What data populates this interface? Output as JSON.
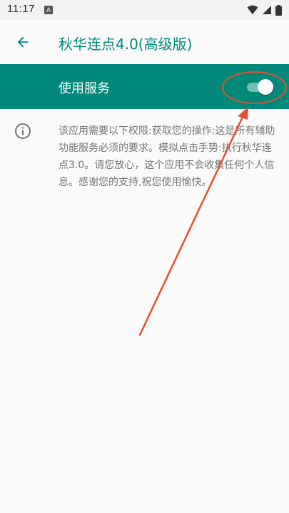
{
  "status_bar": {
    "time": "11:17",
    "notification_icon": "A",
    "icons": [
      "wifi-icon",
      "signal-icon",
      "battery-icon"
    ]
  },
  "app_bar": {
    "back_icon": "arrow-left-icon",
    "title": "秋华连点4.0(高级版)"
  },
  "service": {
    "label": "使用服务",
    "toggle_on": true
  },
  "info": {
    "icon": "info-icon",
    "text": "该应用需要以下权限:获取您的操作:这是所有辅助功能服务必须的要求。模拟点击手势:执行秋华连点3.0。请您放心，这个应用不会收集任何个人信息。感谢您的支持,祝您使用愉快。"
  },
  "colors": {
    "accent": "#00897b",
    "annotation": "#e2502f",
    "text_secondary": "#757575"
  }
}
